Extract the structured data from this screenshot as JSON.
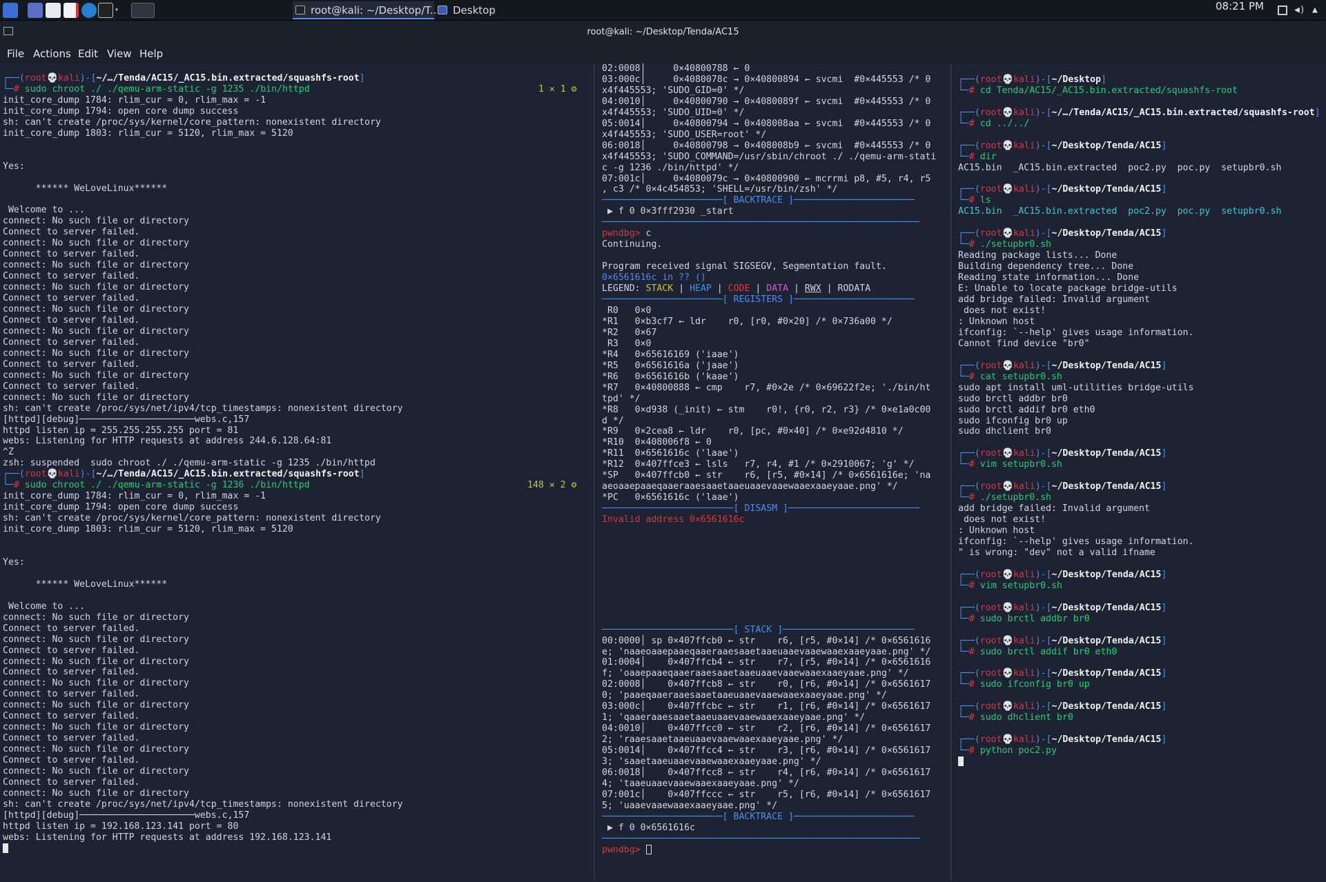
{
  "taskbar": {
    "tasks": [
      {
        "label": "root@kali: ~/Desktop/T..."
      },
      {
        "label": "Desktop"
      }
    ],
    "clock": "08:21 PM"
  },
  "window": {
    "title": "root@kali: ~/Desktop/Tenda/AC15"
  },
  "menu": [
    "File",
    "Actions",
    "Edit",
    "View",
    "Help"
  ],
  "pane_left": {
    "prompt1": {
      "user": "root",
      "host": "kali",
      "path": "~/…/Tenda/AC15/_AC15.bin.extracted/squashfs-root",
      "cmd": "sudo chroot ./ ./qemu-arm-static -g 1235 ./bin/httpd",
      "status": "1 ✕ 1 ⚙"
    },
    "block1": "init_core_dump 1784: rlim_cur = 0, rlim_max = -1\ninit_core_dump 1794: open core dump success\nsh: can't create /proc/sys/kernel/core_pattern: nonexistent directory\ninit_core_dump 1803: rlim_cur = 5120, rlim_max = 5120\n\n\nYes:\n\n      ****** WeLoveLinux******\n\n Welcome to ...\nconnect: No such file or directory\nConnect to server failed.\nconnect: No such file or directory\nConnect to server failed.\nconnect: No such file or directory\nConnect to server failed.\nconnect: No such file or directory\nConnect to server failed.\nconnect: No such file or directory\nConnect to server failed.\nconnect: No such file or directory\nConnect to server failed.\nconnect: No such file or directory\nConnect to server failed.\nconnect: No such file or directory\nConnect to server failed.\nconnect: No such file or directory\nsh: can't create /proc/sys/net/ipv4/tcp_timestamps: nonexistent directory\n[httpd][debug]─────────────────────webs.c,157\nhttpd listen ip = 255.255.255.255 port = 81\nwebs: Listening for HTTP requests at address 244.6.128.64:81\n^Z\nzsh: suspended  sudo chroot ./ ./qemu-arm-static -g 1235 ./bin/httpd",
    "prompt2": {
      "user": "root",
      "host": "kali",
      "path": "~/…/Tenda/AC15/_AC15.bin.extracted/squashfs-root",
      "cmd": "sudo chroot ./ ./qemu-arm-static -g 1236 ./bin/httpd",
      "status": "148 ✕ 2 ⚙"
    },
    "block2": "init_core_dump 1784: rlim_cur = 0, rlim_max = -1\ninit_core_dump 1794: open core dump success\nsh: can't create /proc/sys/kernel/core_pattern: nonexistent directory\ninit_core_dump 1803: rlim_cur = 5120, rlim_max = 5120\n\n\nYes:\n\n      ****** WeLoveLinux******\n\n Welcome to ...\nconnect: No such file or directory\nConnect to server failed.\nconnect: No such file or directory\nConnect to server failed.\nconnect: No such file or directory\nConnect to server failed.\nconnect: No such file or directory\nConnect to server failed.\nconnect: No such file or directory\nConnect to server failed.\nconnect: No such file or directory\nConnect to server failed.\nconnect: No such file or directory\nConnect to server failed.\nconnect: No such file or directory\nConnect to server failed.\nconnect: No such file or directory\nsh: can't create /proc/sys/net/ipv4/tcp_timestamps: nonexistent directory\n[httpd][debug]─────────────────────webs.c,157\nhttpd listen ip = 192.168.123.141 port = 80\nwebs: Listening for HTTP requests at address 192.168.123.141"
  },
  "pane_mid": {
    "top": "02:0008│     0×40800788 ← 0\n03:000c│     0×4080078c → 0×40800894 ← svcmi  #0×445553 /* 0\nx4f445553; 'SUDO_GID=0' */\n04:0010│     0×40800790 → 0×4080089f ← svcmi  #0×445553 /* 0\nx4f445553; 'SUDO_UID=0' */\n05:0014│     0×40800794 → 0×408008aa ← svcmi  #0×445553 /* 0\nx4f445553; 'SUDO_USER=root' */\n06:0018│     0×40800798 → 0×408008b9 ← svcmi  #0×445553 /* 0\nx4f445553; 'SUDO_COMMAND=/usr/sbin/chroot ./ ./qemu-arm-stati\nc -g 1236 ./bin/httpd' */\n07:001c│     0×4080079c → 0×40800900 ← mcrrmi p8, #5, r4, r5\n, c3 /* 0×4c454853; 'SHELL=/usr/bin/zsh' */",
    "bt_header": "[ BACKTRACE ]",
    "bt1": " ▶ f 0 0×3fff2930 _start",
    "cmd_c": "c",
    "continuing": "Continuing.\n\nProgram received signal SIGSEGV, Segmentation fault.",
    "fault": "0×6561616c in ?? ()",
    "legend": {
      "label": "LEGEND:",
      "stack": "STACK",
      "heap": "HEAP",
      "code": "CODE",
      "data": "DATA",
      "rwx": "RWX",
      "rodata": "RODATA"
    },
    "reg_header": "[ REGISTERS ]",
    "regs": " R0   0×0\n*R1   0×b3cf7 ← ldr    r0, [r0, #0×20] /* 0×736a00 */\n*R2   0×67\n R3   0×0\n*R4   0×65616169 ('iaae')\n*R5   0×6561616a ('jaae')\n*R6   0×6561616b ('kaae')\n*R7   0×40800888 ← cmp    r7, #0×2e /* 0×69622f2e; './bin/ht\ntpd' */\n*R8   0×d938 (_init) ← stm    r0!, {r0, r2, r3} /* 0×e1a0c00\nd */\n*R9   0×2cea8 ← ldr    r0, [pc, #0×40] /* 0×e92d4810 */\n*R10  0×408006f8 ← 0\n*R11  0×6561616c ('laae')\n*R12  0×407ffce3 ← lsls   r7, r4, #1 /* 0×2910067; 'g' */\n*SP   0×407ffcb0 ← str    r6, [r5, #0×14] /* 0×6561616e; 'na\naeoaaepaaeqaaeraaesaaetaaeuaaevaaewaaexaaeyaae.png' */\n*PC   0×6561616c ('laae')",
    "disasm_header": "[ DISASM ]",
    "invalid": "Invalid address 0×6561616c",
    "stack_header": "[ STACK ]",
    "stack": "00:0000│ sp 0×407ffcb0 ← str    r6, [r5, #0×14] /* 0×6561616\ne; 'naaeoaaepaaeqaaeraaesaaetaaeuaaevaaewaaexaaeyaae.png' */\n01:0004│    0×407ffcb4 ← str    r7, [r5, #0×14] /* 0×6561616\nf; 'oaaepaaeqaaeraaesaaetaaeuaaevaaewaaexaaeyaae.png' */\n02:0008│    0×407ffcb8 ← str    r0, [r6, #0×14] /* 0×6561617\n0; 'paaeqaaeraaesaaetaaeuaaevaaewaaexaaeyaae.png' */\n03:000c│    0×407ffcbc ← str    r1, [r6, #0×14] /* 0×6561617\n1; 'qaaeraaesaaetaaeuaaevaaewaaexaaeyaae.png' */\n04:0010│    0×407ffcc0 ← str    r2, [r6, #0×14] /* 0×6561617\n2; 'raaesaaetaaeuaaevaaewaaexaaeyaae.png' */\n05:0014│    0×407ffcc4 ← str    r3, [r6, #0×14] /* 0×6561617\n3; 'saaetaaeuaaevaaewaaexaaeyaae.png' */\n06:0018│    0×407ffcc8 ← str    r4, [r6, #0×14] /* 0×6561617\n4; 'taaeuaaevaaewaaexaaeyaae.png' */\n07:001c│    0×407ffccc ← str    r5, [r6, #0×14] /* 0×6561617\n5; 'uaaevaaewaaexaaeyaae.png' */",
    "bt2": " ▶ f 0 0×6561616c",
    "pwndbg": "pwndbg>"
  },
  "pane_right": {
    "entries": [
      {
        "path": "~/Desktop",
        "cmd": "cd Tenda/AC15/_AC15.bin.extracted/squashfs-root",
        "out": ""
      },
      {
        "path": "~/…/Tenda/AC15/_AC15.bin.extracted/squashfs-root",
        "cmd": "cd ../../",
        "out": ""
      },
      {
        "path": "~/Desktop/Tenda/AC15",
        "cmd": "dir",
        "out": "AC15.bin  _AC15.bin.extracted  poc2.py  poc.py  setupbr0.sh"
      },
      {
        "path": "~/Desktop/Tenda/AC15",
        "cmd": "ls",
        "out": "AC15.bin  _AC15.bin.extracted  poc2.py  poc.py  setupbr0.sh"
      },
      {
        "path": "~/Desktop/Tenda/AC15",
        "cmd": "./setupbr0.sh",
        "out": "Reading package lists... Done\nBuilding dependency tree... Done\nReading state information... Done\nE: Unable to locate package bridge-utils\nadd bridge failed: Invalid argument\n does not exist!\n: Unknown host\nifconfig: `--help' gives usage information.\nCannot find device \"br0\""
      },
      {
        "path": "~/Desktop/Tenda/AC15",
        "cmd": "cat setupbr0.sh",
        "out": "sudo apt install uml-utilities bridge-utils\nsudo brctl addbr br0\nsudo brctl addif br0 eth0\nsudo ifconfig br0 up\nsudo dhclient br0"
      },
      {
        "path": "~/Desktop/Tenda/AC15",
        "cmd": "vim setupbr0.sh",
        "out": ""
      },
      {
        "path": "~/Desktop/Tenda/AC15",
        "cmd": "./setupbr0.sh",
        "out": "add bridge failed: Invalid argument\n does not exist!\n: Unknown host\nifconfig: `--help' gives usage information.\n\" is wrong: \"dev\" not a valid ifname"
      },
      {
        "path": "~/Desktop/Tenda/AC15",
        "cmd": "vim setupbr0.sh",
        "out": ""
      },
      {
        "path": "~/Desktop/Tenda/AC15",
        "cmd": "sudo brctl addbr br0",
        "out": ""
      },
      {
        "path": "~/Desktop/Tenda/AC15",
        "cmd": "sudo brctl addif br0 eth0",
        "out": ""
      },
      {
        "path": "~/Desktop/Tenda/AC15",
        "cmd": "sudo ifconfig br0 up",
        "out": ""
      },
      {
        "path": "~/Desktop/Tenda/AC15",
        "cmd": "sudo dhclient br0",
        "out": ""
      },
      {
        "path": "~/Desktop/Tenda/AC15",
        "cmd": "python poc2.py",
        "out": ""
      }
    ]
  },
  "colors": {
    "prompt_red": "#e0343f",
    "prompt_blue": "#4d8cf0",
    "addr_red": "#e0343f",
    "ins_green": "#20d070",
    "bg": "#1d2333"
  }
}
